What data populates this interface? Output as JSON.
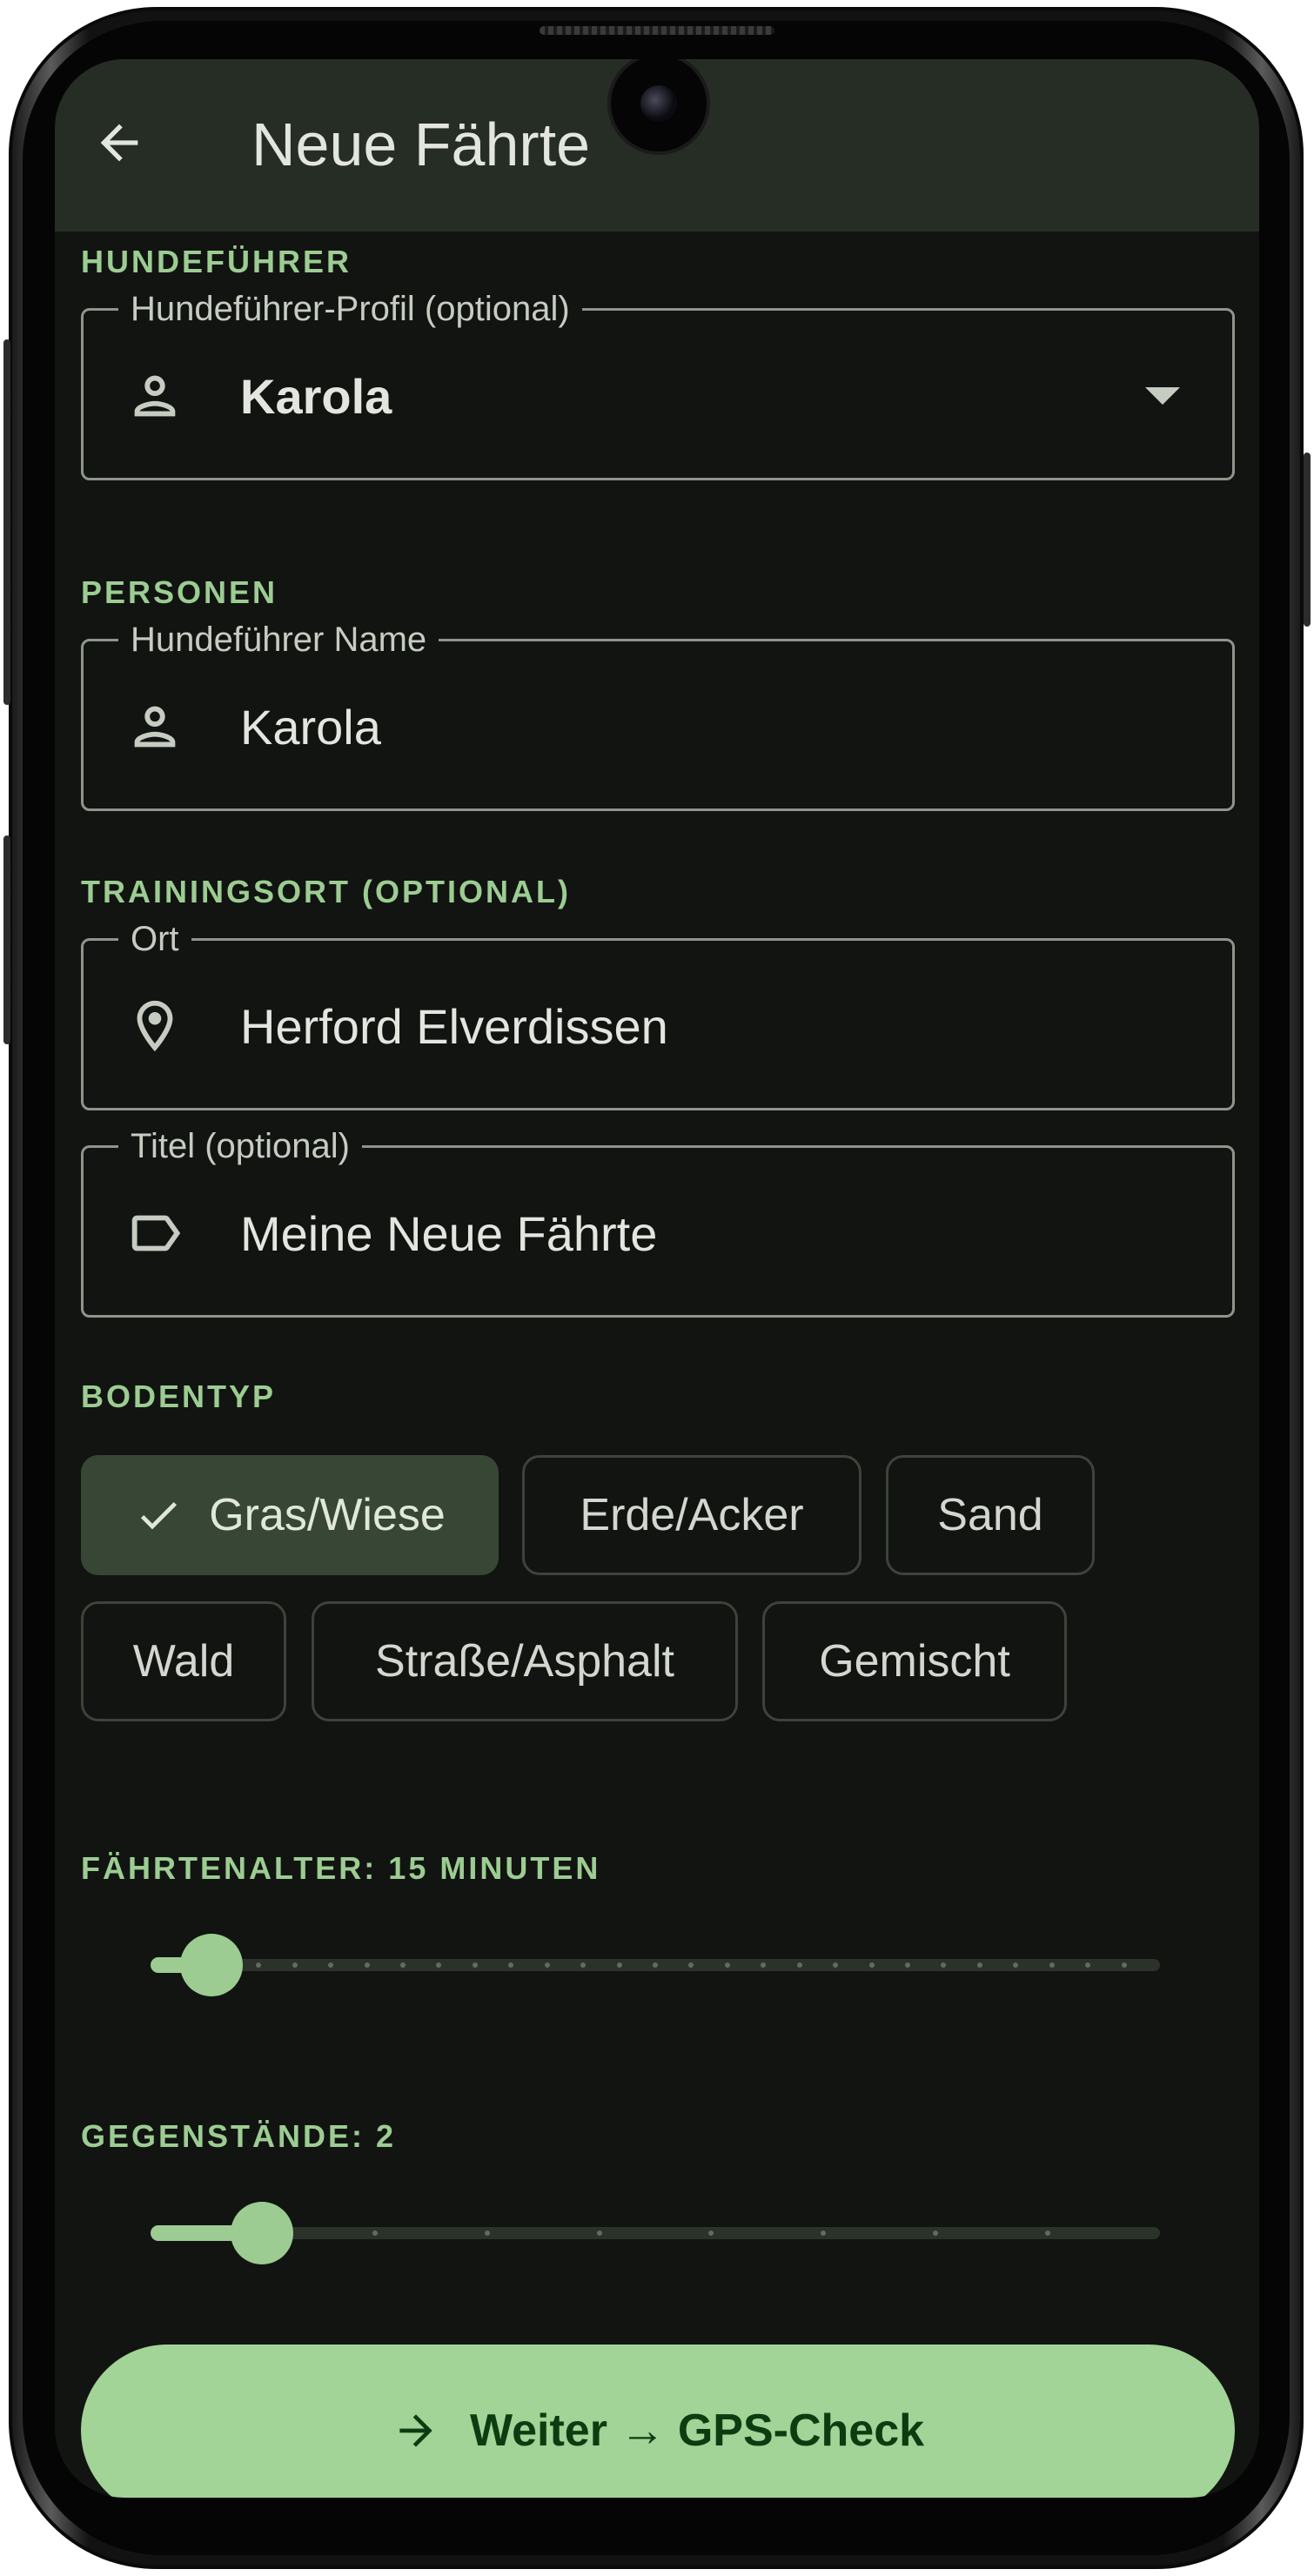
{
  "app_bar": {
    "title": "Neue Fährte",
    "back_icon": "arrow-left-icon"
  },
  "sections": {
    "handler": "HUNDEFÜHRER",
    "persons": "PERSONEN",
    "location": "TRAININGSORT (OPTIONAL)",
    "ground": "BODENTYP",
    "track_age": "FÄHRTENALTER: 15 MINUTEN",
    "items": "GEGENSTÄNDE: 2"
  },
  "fields": {
    "profile": {
      "label": "Hundeführer-Profil (optional)",
      "value": "Karola",
      "icon": "person-icon"
    },
    "handler_name": {
      "label": "Hundeführer Name",
      "value": "Karola",
      "icon": "person-icon"
    },
    "location": {
      "label": "Ort",
      "value": "Herford Elverdissen",
      "icon": "location-pin-icon"
    },
    "title": {
      "label": "Titel (optional)",
      "value": "Meine Neue Fährte",
      "icon": "label-tag-icon"
    }
  },
  "ground_types": [
    {
      "label": "Gras/Wiese",
      "selected": true
    },
    {
      "label": "Erde/Acker",
      "selected": false
    },
    {
      "label": "Sand",
      "selected": false
    },
    {
      "label": "Wald",
      "selected": false
    },
    {
      "label": "Straße/Asphalt",
      "selected": false
    },
    {
      "label": "Gemischt",
      "selected": false
    }
  ],
  "sliders": {
    "track_age": {
      "value_fraction": 0.06,
      "steps": 28
    },
    "items": {
      "value_fraction": 0.11,
      "steps": 9
    }
  },
  "colors": {
    "accent": "#9ccc92",
    "background": "#111411",
    "app_bar": "#262d25",
    "primary_button": "#a2d397",
    "primary_button_text": "#0c3d11"
  },
  "primary_button": {
    "label": "Weiter → GPS-Check",
    "icon": "arrow-right-icon"
  }
}
